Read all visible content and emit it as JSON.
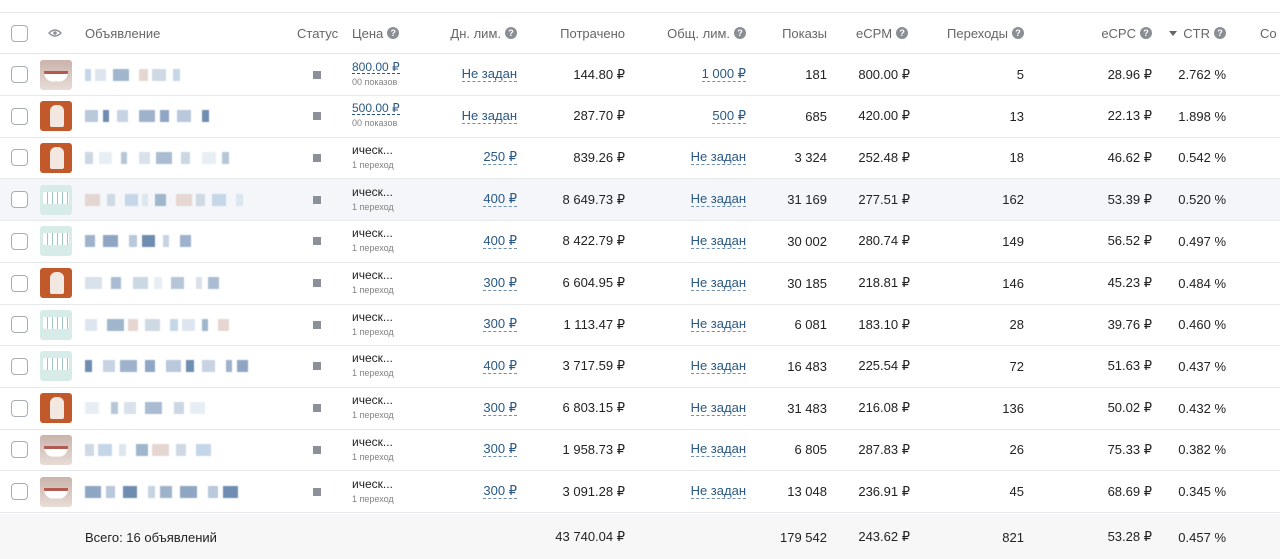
{
  "header": {
    "ad": "Объявление",
    "status": "Статус",
    "price": "Цена",
    "day_limit": "Дн. лим.",
    "spent": "Потрачено",
    "total_limit": "Общ. лим.",
    "shows": "Показы",
    "ecpm": "eCPM",
    "clicks": "Переходы",
    "ecpc": "eCPC",
    "ctr": "CTR",
    "cons": "Со",
    "help_glyph": "?"
  },
  "rows": [
    {
      "thumb": "smile",
      "price": "800.00 ₽",
      "price_sub": "00 показов",
      "price_link": true,
      "day_limit": "Не задан",
      "spent": "144.80 ₽",
      "total_limit": "1 000 ₽",
      "shows": "181",
      "ecpm": "800.00 ₽",
      "clicks": "5",
      "ecpc": "28.96 ₽",
      "ctr": "2.762 %"
    },
    {
      "thumb": "orange",
      "price": "500.00 ₽",
      "price_sub": "00 показов",
      "price_link": true,
      "day_limit": "Не задан",
      "spent": "287.70 ₽",
      "total_limit": "500 ₽",
      "shows": "685",
      "ecpm": "420.00 ₽",
      "clicks": "13",
      "ecpc": "22.13 ₽",
      "ctr": "1.898 %"
    },
    {
      "thumb": "orange",
      "price": "ическ...",
      "price_sub": "1 переход",
      "price_link": false,
      "day_limit": "250 ₽",
      "spent": "839.26 ₽",
      "total_limit": "Не задан",
      "shows": "3 324",
      "ecpm": "252.48 ₽",
      "clicks": "18",
      "ecpc": "46.62 ₽",
      "ctr": "0.542 %"
    },
    {
      "thumb": "teeth",
      "price": "ическ...",
      "price_sub": "1 переход",
      "price_link": false,
      "day_limit": "400 ₽",
      "spent": "8 649.73 ₽",
      "total_limit": "Не задан",
      "shows": "31 169",
      "ecpm": "277.51 ₽",
      "clicks": "162",
      "ecpc": "53.39 ₽",
      "ctr": "0.520 %"
    },
    {
      "thumb": "teeth",
      "price": "ическ...",
      "price_sub": "1 переход",
      "price_link": false,
      "day_limit": "400 ₽",
      "spent": "8 422.79 ₽",
      "total_limit": "Не задан",
      "shows": "30 002",
      "ecpm": "280.74 ₽",
      "clicks": "149",
      "ecpc": "56.52 ₽",
      "ctr": "0.497 %"
    },
    {
      "thumb": "orange",
      "price": "ическ...",
      "price_sub": "1 переход",
      "price_link": false,
      "day_limit": "300 ₽",
      "spent": "6 604.95 ₽",
      "total_limit": "Не задан",
      "shows": "30 185",
      "ecpm": "218.81 ₽",
      "clicks": "146",
      "ecpc": "45.23 ₽",
      "ctr": "0.484 %"
    },
    {
      "thumb": "teeth",
      "price": "ическ...",
      "price_sub": "1 переход",
      "price_link": false,
      "day_limit": "300 ₽",
      "spent": "1 113.47 ₽",
      "total_limit": "Не задан",
      "shows": "6 081",
      "ecpm": "183.10 ₽",
      "clicks": "28",
      "ecpc": "39.76 ₽",
      "ctr": "0.460 %"
    },
    {
      "thumb": "teeth",
      "price": "ическ...",
      "price_sub": "1 переход",
      "price_link": false,
      "day_limit": "400 ₽",
      "spent": "3 717.59 ₽",
      "total_limit": "Не задан",
      "shows": "16 483",
      "ecpm": "225.54 ₽",
      "clicks": "72",
      "ecpc": "51.63 ₽",
      "ctr": "0.437 %"
    },
    {
      "thumb": "orange",
      "price": "ическ...",
      "price_sub": "1 переход",
      "price_link": false,
      "day_limit": "300 ₽",
      "spent": "6 803.15 ₽",
      "total_limit": "Не задан",
      "shows": "31 483",
      "ecpm": "216.08 ₽",
      "clicks": "136",
      "ecpc": "50.02 ₽",
      "ctr": "0.432 %"
    },
    {
      "thumb": "smile",
      "price": "ическ...",
      "price_sub": "1 переход",
      "price_link": false,
      "day_limit": "300 ₽",
      "spent": "1 958.73 ₽",
      "total_limit": "Не задан",
      "shows": "6 805",
      "ecpm": "287.83 ₽",
      "clicks": "26",
      "ecpc": "75.33 ₽",
      "ctr": "0.382 %"
    },
    {
      "thumb": "smile",
      "price": "ическ...",
      "price_sub": "1 переход",
      "price_link": false,
      "day_limit": "300 ₽",
      "spent": "3 091.28 ₽",
      "total_limit": "Не задан",
      "shows": "13 048",
      "ecpm": "236.91 ₽",
      "clicks": "45",
      "ecpc": "68.69 ₽",
      "ctr": "0.345 %"
    }
  ],
  "total": {
    "label": "Всего: 16 объявлений",
    "spent": "43 740.04 ₽",
    "shows": "179 542",
    "ecpm": "243.62 ₽",
    "clicks": "821",
    "ecpc": "53.28 ₽",
    "ctr": "0.457 %"
  },
  "highlighted_row": 3,
  "colors": {
    "link": "#2a5885",
    "border": "#e7e8ec",
    "highlight": "#f4f6f9",
    "status_icon": "#8c9199"
  }
}
